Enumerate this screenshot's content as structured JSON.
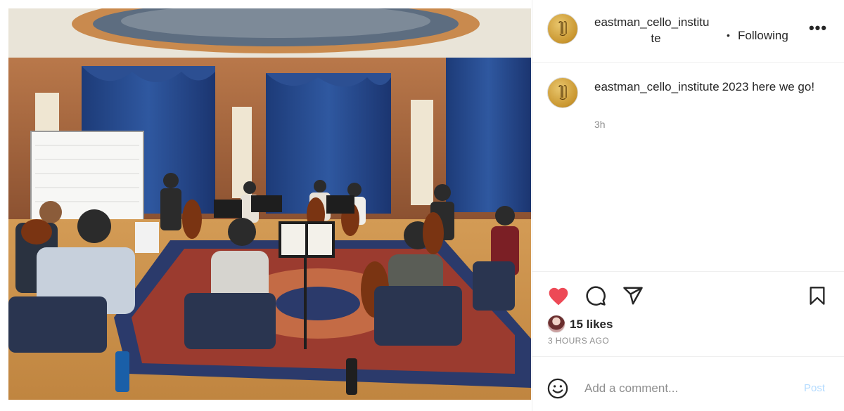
{
  "post": {
    "image_alt": "Cello class rehearsing in a circle in a wood-paneled room with blue curtains",
    "author": {
      "username_line1": "eastman_cello_institu",
      "username_line2": "te"
    },
    "header": {
      "separator": "•",
      "follow_label": "Following",
      "more_label": "•••"
    },
    "caption": {
      "username": "eastman_cello_institute",
      "text": "2023 here we go!",
      "time": "3h"
    },
    "actions": {
      "like_icon": "heart-filled-icon",
      "comment_icon": "comment-icon",
      "share_icon": "share-icon",
      "save_icon": "bookmark-icon",
      "like_color": "#ed4956"
    },
    "likes_label": "15 likes",
    "posted_label": "3 HOURS AGO",
    "comment": {
      "placeholder": "Add a comment...",
      "post_label": "Post"
    }
  }
}
